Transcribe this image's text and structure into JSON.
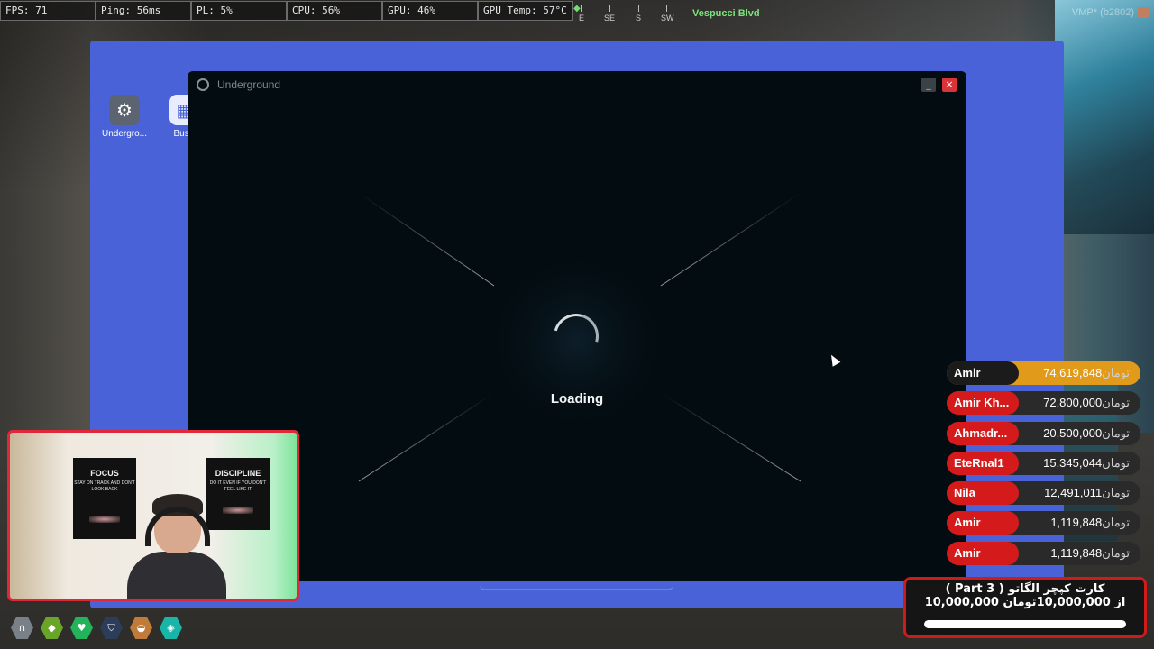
{
  "hud": {
    "fps": "FPS: 71",
    "ping": "Ping: 56ms",
    "pl": "PL: 5%",
    "cpu": "CPU: 56%",
    "gpu": "GPU: 46%",
    "gpu_temp": "GPU Temp: 57°C",
    "compass": [
      "E",
      "SE",
      "S",
      "SW"
    ],
    "street": "Vespucci Blvd",
    "server_id": "VMP* (b2802)"
  },
  "desktop": {
    "icons": [
      {
        "label": "Undergro...",
        "icon": "turbo-icon",
        "color": "#5b6470"
      },
      {
        "label": "Busin",
        "icon": "grid-icon",
        "color": "#e9ebff"
      },
      {
        "label": "",
        "icon": "folder-icon",
        "color": "#e8b84a"
      },
      {
        "label": "",
        "icon": "app-green-icon",
        "color": "#4bbf6a"
      },
      {
        "label": "",
        "icon": "home-icon",
        "color": "#4a90d9"
      },
      {
        "label": "",
        "icon": "image-icon",
        "color": "#6fb0e8"
      }
    ]
  },
  "window": {
    "title": "Underground",
    "minimize_label": "_",
    "close_label": "×",
    "loading": "Loading"
  },
  "webcam": {
    "poster1_title": "FOCUS",
    "poster1_sub": "STAY ON TRACK AND DON'T LOOK BACK",
    "poster2_title": "DISCIPLINE",
    "poster2_sub": "DO IT EVEN IF YOU DON'T FEEL LIKE IT"
  },
  "hud_icons": [
    {
      "icon": "headset-icon",
      "color": "#7a8088"
    },
    {
      "icon": "food-icon",
      "color": "#6aa52a"
    },
    {
      "icon": "health-icon",
      "color": "#23b35a"
    },
    {
      "icon": "armor-icon",
      "color": "#2c3d5a"
    },
    {
      "icon": "hunger-icon",
      "color": "#c07a3a"
    },
    {
      "icon": "water-icon",
      "color": "#18b5a8"
    }
  ],
  "leaderboard": {
    "currency": "تومان",
    "rows": [
      {
        "name": "Amir",
        "amount": "74,619,848"
      },
      {
        "name": "Amir Kh...",
        "amount": "72,800,000"
      },
      {
        "name": "Ahmadr...",
        "amount": "20,500,000"
      },
      {
        "name": "EteRnal1",
        "amount": "15,345,044"
      },
      {
        "name": "Nila",
        "amount": "12,491,011"
      },
      {
        "name": "Amir",
        "amount": "1,119,848"
      },
      {
        "name": "Amir",
        "amount": "1,119,848"
      }
    ]
  },
  "goal": {
    "title": "( Part 3 ) کارت کپچر الگاتو",
    "progress": "10,000,000 از 10,000,000تومان",
    "fraction": 1.0
  }
}
